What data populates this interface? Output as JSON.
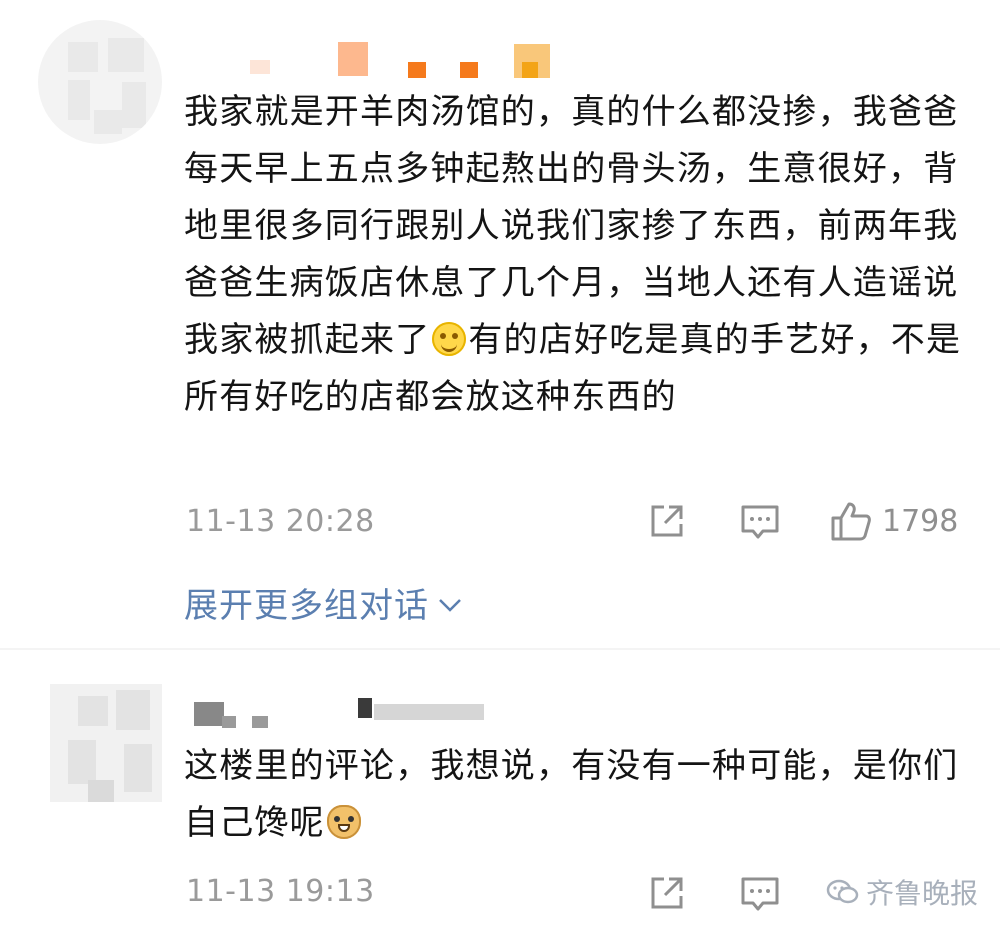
{
  "comments": [
    {
      "text_parts": {
        "before_emoji": "我家就是开羊肉汤馆的，真的什么都没掺，我爸爸每天早上五点多钟起熬出的骨头汤，生意很好，背地里很多同行跟别人说我们家掺了东西，前两年我爸爸生病饭店休息了几个月，当地人还有人造谣说我家被抓起来了",
        "emoji": "smile-emoji",
        "after_emoji": "有的店好吃是真的手艺好，不是所有好吃的店都会放这种东西的"
      },
      "timestamp": "11-13 20:28",
      "like_count": "1798",
      "expand_label": "展开更多组对话"
    },
    {
      "text_parts": {
        "before_emoji": "这楼里的评论，我想说，有没有一种可能，是你们自己馋呢",
        "emoji": "doge-emoji"
      },
      "timestamp": "11-13 19:13"
    }
  ],
  "icons": {
    "share": "share-icon",
    "comment": "comment-icon",
    "like": "thumbs-up-icon",
    "expand": "chevron-down-icon",
    "watermark": "wechat-icon"
  },
  "watermark_text": "齐鲁晚报",
  "colors": {
    "text": "#141414",
    "meta": "#9a9a9a",
    "link": "#5b7fb0"
  }
}
